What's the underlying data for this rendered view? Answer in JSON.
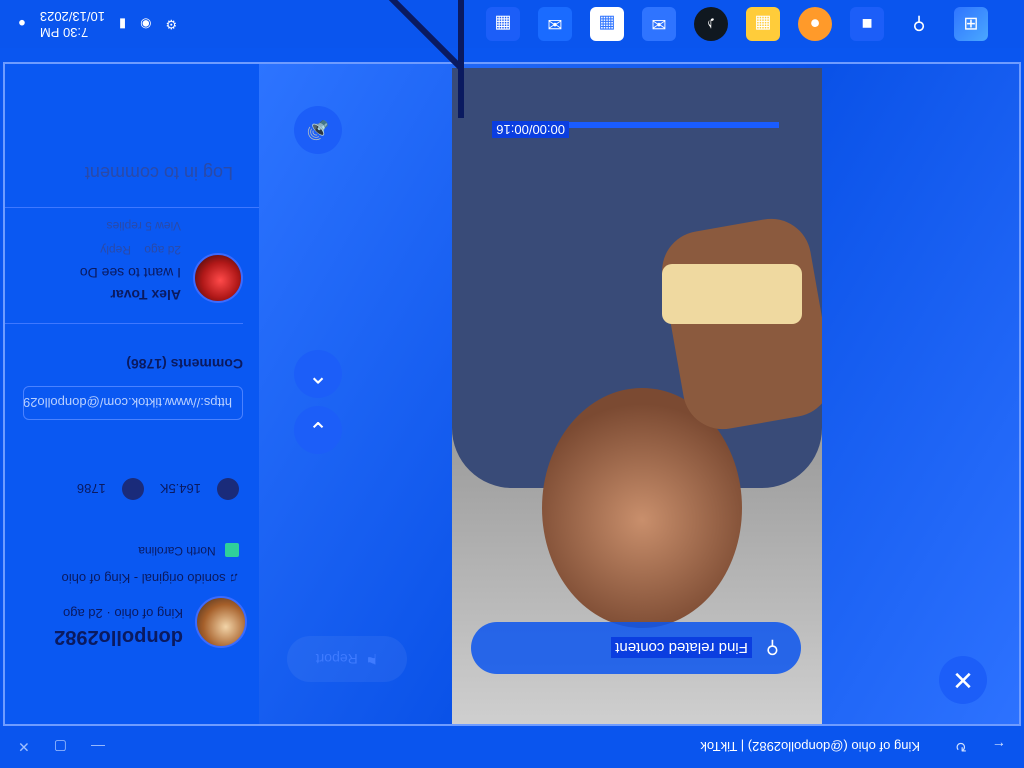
{
  "window": {
    "title": "King of ohio (@donpollo2982) | TikTok",
    "controls": [
      "back",
      "refresh",
      "minimize",
      "maximize",
      "close"
    ]
  },
  "main": {
    "report_label": "Report",
    "close_icon": "close-icon",
    "find_related": "Find related content",
    "timecode": "00:00/00:16",
    "progress": 1.0
  },
  "panel": {
    "author_name": "donpollo2982",
    "author_sub": "King of ohio · 2d ago",
    "music": "sonido original - King of ohio",
    "location": "North Carolina",
    "likes": "164.5K",
    "comments_count": "1786",
    "link": "https://www.tiktok.com/@donpollo2982",
    "comments_header": "Comments (1786)",
    "comment": {
      "name": "Alex Tovar",
      "text": "I want to see Do",
      "meta_time": "2d ago",
      "meta_reply": "Reply",
      "replies": "View 5 replies"
    },
    "login_prompt": "Log in to comment"
  },
  "taskbar": {
    "apps": [
      "windows-start",
      "search",
      "task-view",
      "chrome",
      "file-explorer",
      "tiktok",
      "mail",
      "store",
      "outlook",
      "widgets"
    ],
    "clock_time": "7:30 PM",
    "clock_date": "10/13/2023"
  }
}
